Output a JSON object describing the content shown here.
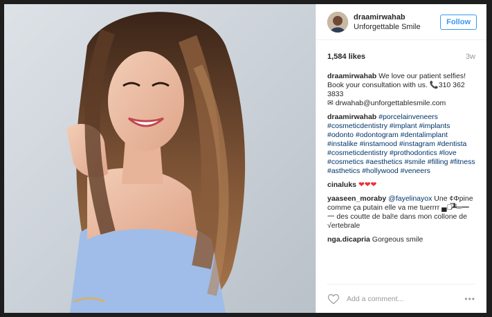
{
  "post": {
    "author": {
      "username": "draamirwahab",
      "location": "Unforgettable Smile",
      "follow_label": "Follow"
    },
    "likes": "1,584 likes",
    "age": "3w",
    "caption": {
      "username": "draamirwahab",
      "text_line1": "We love our patient selfies! Book your consultation with us. 📞310 362 3833",
      "text_line2": "✉ drwahab@unforgettablesmile.com"
    },
    "comments": [
      {
        "username": "draamirwahab",
        "text": "#porcelainveneers #cosmeticdentistry #implant #implants #odonto #odontogram #dentalimplant #instalike #instamood #instagram #dentista #cosmeticdentistry #prothodontics #love #cosmetics #aesthetics #smile #filling #fitness #asthetics #hollywood #veneers"
      },
      {
        "username": "cinaluks",
        "text": "❤❤❤"
      },
      {
        "username": "yaaseen_moraby",
        "mention": "@fayelinayox",
        "text": "Une ¢Φpine comme ça putain elle va me tuerrrr ▄︻̷̿┻̿═━一 des coutte de bal!e dans mon collone de √ertebrale"
      },
      {
        "username": "nga.dicapria",
        "text": "Gorgeous smile"
      }
    ],
    "add_comment_placeholder": "Add a comment...",
    "more_label": "•••",
    "colors": {
      "link": "#003569",
      "follow": "#3897f0",
      "heart": "#ed2f33"
    }
  }
}
